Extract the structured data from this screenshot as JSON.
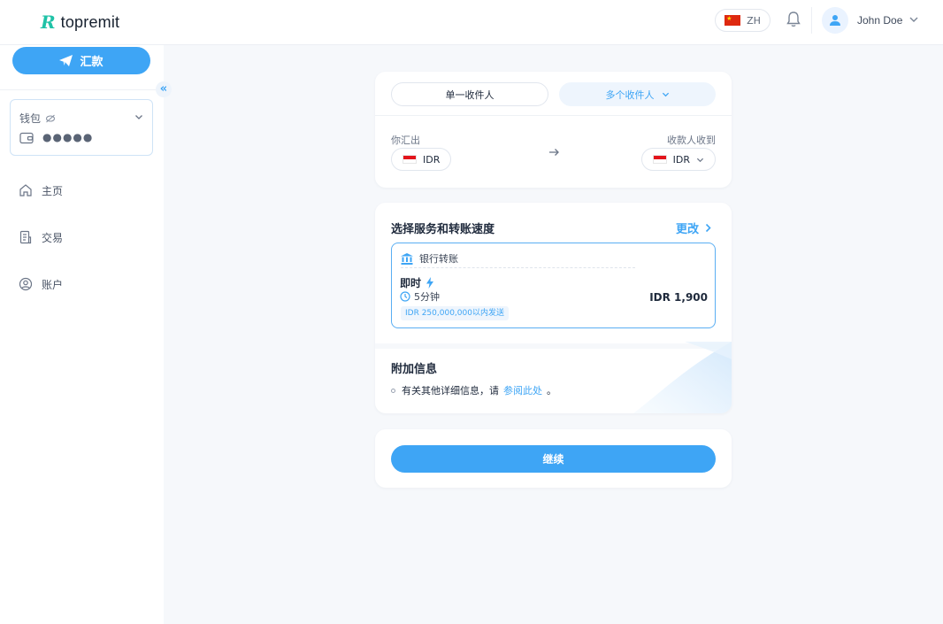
{
  "header": {
    "logo_mark": "R",
    "logo_text": "topremit",
    "language": "ZH",
    "user_name": "John Doe"
  },
  "sidebar": {
    "remit_label": "汇款",
    "collapse_glyph": "«",
    "wallet_label": "钱包",
    "wallet_balance": "●●●●●",
    "nav": [
      {
        "label": "主页",
        "icon": "home-icon"
      },
      {
        "label": "交易",
        "icon": "document-icon"
      },
      {
        "label": "账户",
        "icon": "user-circle-icon"
      }
    ]
  },
  "recipient": {
    "tab_single": "单一收件人",
    "tab_multi": "多个收件人",
    "send_label": "你汇出",
    "recv_label": "收款人收到",
    "send_currency": "IDR",
    "recv_currency": "IDR"
  },
  "service": {
    "title": "选择服务和转账速度",
    "change_label": "更改",
    "method": "银行转账",
    "speed": "即时",
    "eta": "5分钟",
    "limit": "IDR 250,000,000以内发送",
    "price": "IDR 1,900"
  },
  "extra": {
    "title": "附加信息",
    "text": "有关其他详细信息，请",
    "link": "参阅此处",
    "suffix": "。"
  },
  "action": {
    "continue_label": "继续"
  },
  "colors": {
    "accent": "#3ea5f5",
    "brand": "#1fc2a7",
    "flag_id_red": "#e3141b",
    "flag_cn_red": "#de2910"
  }
}
